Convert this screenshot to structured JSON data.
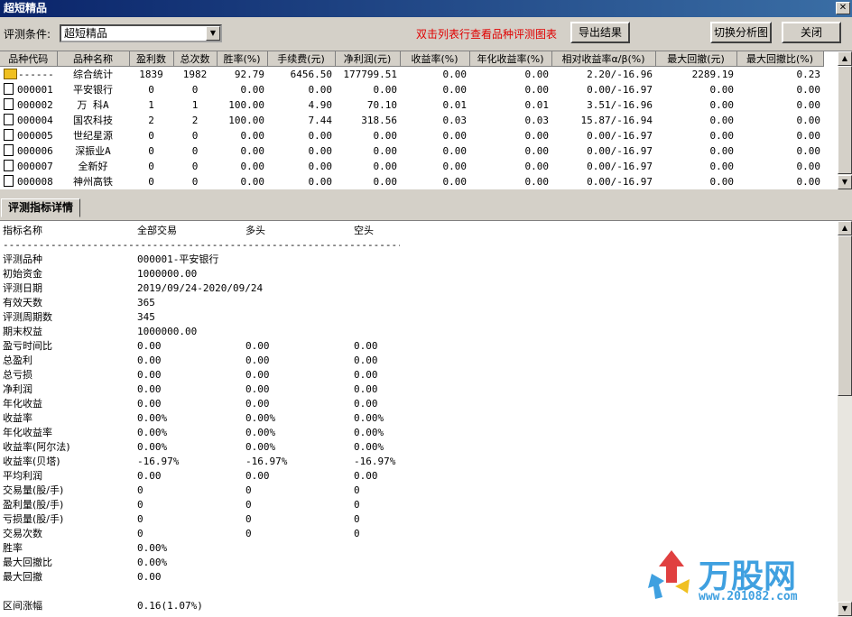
{
  "window": {
    "title": "超短精品",
    "close_glyph": "✕"
  },
  "toolbar": {
    "condition_label": "评测条件:",
    "condition_value": "超短精品",
    "hint": "双击列表行查看品种评测图表",
    "export_label": "导出结果",
    "switch_label": "切换分析图",
    "close_label": "关闭"
  },
  "grid": {
    "columns": [
      "品种代码",
      "品种名称",
      "盈利数",
      "总次数",
      "胜率(%)",
      "手续费(元)",
      "净利润(元)",
      "收益率(%)",
      "年化收益率(%)",
      "相对收益率α/β(%)",
      "最大回撤(元)",
      "最大回撤比(%)"
    ],
    "rows": [
      [
        "------",
        "综合统计",
        "1839",
        "1982",
        "92.79",
        "6456.50",
        "177799.51",
        "0.00",
        "0.00",
        "2.20/-16.96",
        "2289.19",
        "0.23"
      ],
      [
        "000001",
        "平安银行",
        "0",
        "0",
        "0.00",
        "0.00",
        "0.00",
        "0.00",
        "0.00",
        "0.00/-16.97",
        "0.00",
        "0.00"
      ],
      [
        "000002",
        "万 科A",
        "1",
        "1",
        "100.00",
        "4.90",
        "70.10",
        "0.01",
        "0.01",
        "3.51/-16.96",
        "0.00",
        "0.00"
      ],
      [
        "000004",
        "国农科技",
        "2",
        "2",
        "100.00",
        "7.44",
        "318.56",
        "0.03",
        "0.03",
        "15.87/-16.94",
        "0.00",
        "0.00"
      ],
      [
        "000005",
        "世纪星源",
        "0",
        "0",
        "0.00",
        "0.00",
        "0.00",
        "0.00",
        "0.00",
        "0.00/-16.97",
        "0.00",
        "0.00"
      ],
      [
        "000006",
        "深振业A",
        "0",
        "0",
        "0.00",
        "0.00",
        "0.00",
        "0.00",
        "0.00",
        "0.00/-16.97",
        "0.00",
        "0.00"
      ],
      [
        "000007",
        "全新好",
        "0",
        "0",
        "0.00",
        "0.00",
        "0.00",
        "0.00",
        "0.00",
        "0.00/-16.97",
        "0.00",
        "0.00"
      ],
      [
        "000008",
        "神州高铁",
        "0",
        "0",
        "0.00",
        "0.00",
        "0.00",
        "0.00",
        "0.00",
        "0.00/-16.97",
        "0.00",
        "0.00"
      ]
    ]
  },
  "detail": {
    "tab_label": "评测指标详情",
    "header": [
      "指标名称",
      "全部交易",
      "多头",
      "空头"
    ],
    "separator": "------------------------------------------------------------------------",
    "rows": [
      [
        "评测品种",
        "000001-平安银行",
        "",
        ""
      ],
      [
        "初始资金",
        "1000000.00",
        "",
        ""
      ],
      [
        "评测日期",
        "2019/09/24-2020/09/24",
        "",
        ""
      ],
      [
        "有效天数",
        "365",
        "",
        ""
      ],
      [
        "评测周期数",
        "345",
        "",
        ""
      ],
      [
        "期末权益",
        "1000000.00",
        "",
        ""
      ],
      [
        "盈亏时间比",
        "0.00",
        "0.00",
        "0.00"
      ],
      [
        "总盈利",
        "0.00",
        "0.00",
        "0.00"
      ],
      [
        "总亏损",
        "0.00",
        "0.00",
        "0.00"
      ],
      [
        "净利润",
        "0.00",
        "0.00",
        "0.00"
      ],
      [
        "年化收益",
        "0.00",
        "0.00",
        "0.00"
      ],
      [
        "收益率",
        "0.00%",
        "0.00%",
        "0.00%"
      ],
      [
        "年化收益率",
        "0.00%",
        "0.00%",
        "0.00%"
      ],
      [
        "收益率(阿尔法)",
        "0.00%",
        "0.00%",
        "0.00%"
      ],
      [
        "收益率(贝塔)",
        "-16.97%",
        "-16.97%",
        "-16.97%"
      ],
      [
        "平均利润",
        "0.00",
        "0.00",
        "0.00"
      ],
      [
        "交易量(股/手)",
        "0",
        "0",
        "0"
      ],
      [
        "盈利量(股/手)",
        "0",
        "0",
        "0"
      ],
      [
        "亏损量(股/手)",
        "0",
        "0",
        "0"
      ],
      [
        "交易次数",
        "0",
        "0",
        "0"
      ],
      [
        "胜率",
        "0.00%",
        "",
        ""
      ],
      [
        "最大回撤比",
        "0.00%",
        "",
        ""
      ],
      [
        "最大回撤",
        "0.00",
        "",
        ""
      ],
      [
        "",
        "",
        "",
        ""
      ],
      [
        "区间涨幅",
        "0.16(1.07%)",
        "",
        ""
      ]
    ]
  },
  "watermark": {
    "brand": "万股网",
    "url": "www.201082.com"
  }
}
